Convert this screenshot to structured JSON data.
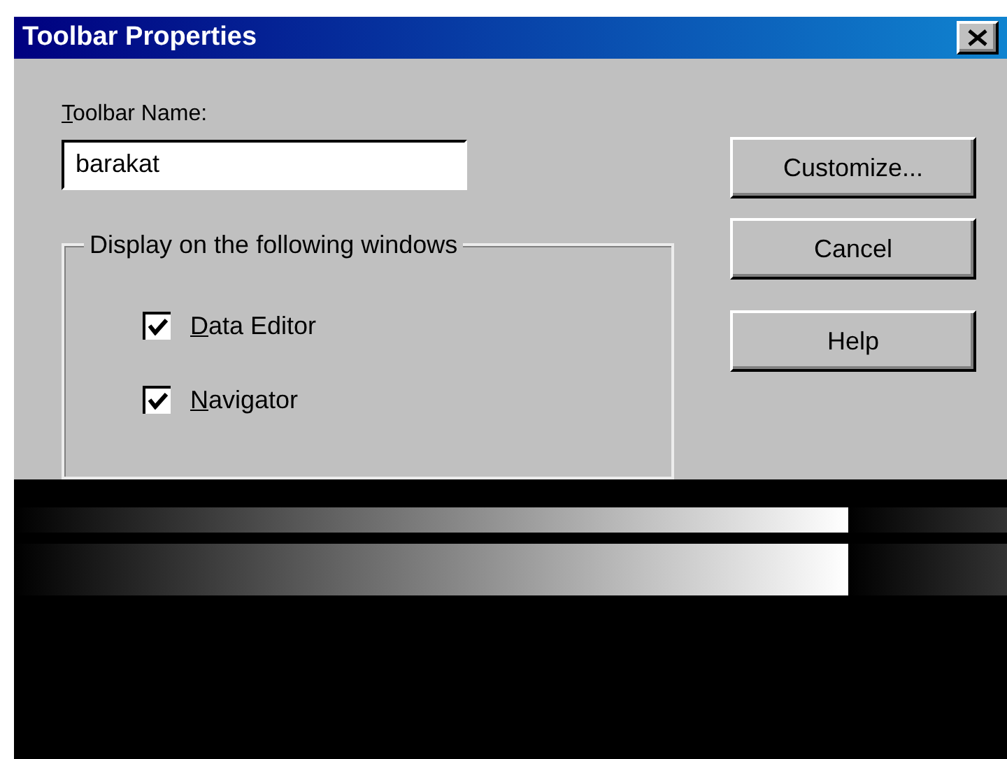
{
  "window": {
    "title": "Toolbar Properties"
  },
  "toolbar_name": {
    "label": "Toolbar Name:",
    "value": "barakat"
  },
  "buttons": [
    {
      "label": "Customize..."
    },
    {
      "label": "Cancel"
    },
    {
      "label": "Help"
    }
  ],
  "group": {
    "legend": "Display on the following windows",
    "options": [
      {
        "label": "Data Editor",
        "checked": true
      },
      {
        "label": "Navigator",
        "checked": true
      }
    ]
  }
}
